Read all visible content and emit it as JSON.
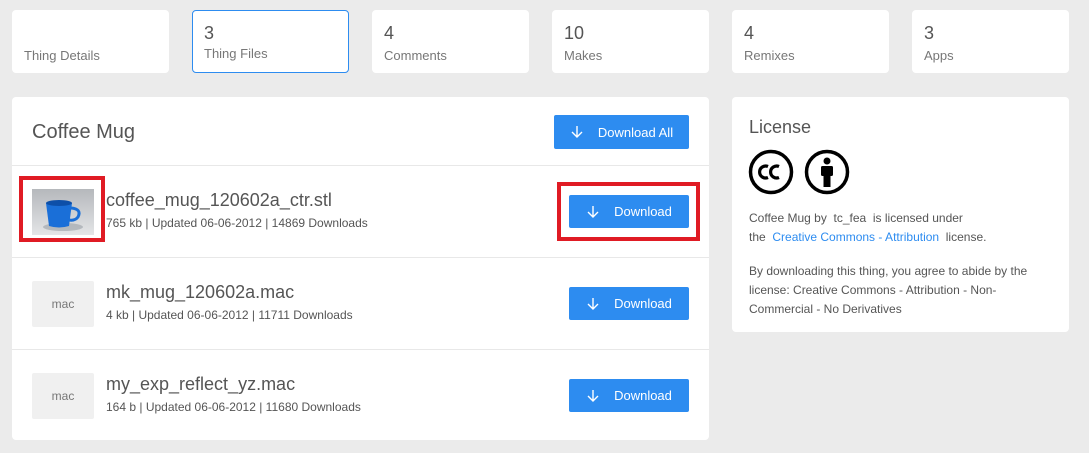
{
  "tabs": [
    {
      "count": "",
      "label": "Thing Details"
    },
    {
      "count": "3",
      "label": "Thing Files"
    },
    {
      "count": "4",
      "label": "Comments"
    },
    {
      "count": "10",
      "label": "Makes"
    },
    {
      "count": "4",
      "label": "Remixes"
    },
    {
      "count": "3",
      "label": "Apps"
    }
  ],
  "files": {
    "title": "Coffee Mug",
    "download_all_label": "Download All",
    "rows": [
      {
        "thumb": "",
        "name": "coffee_mug_120602a_ctr.stl",
        "meta": "765 kb | Updated 06-06-2012 | 14869 Downloads",
        "button": "Download"
      },
      {
        "thumb": "mac",
        "name": "mk_mug_120602a.mac",
        "meta": "4 kb | Updated 06-06-2012 | 11711 Downloads",
        "button": "Download"
      },
      {
        "thumb": "mac",
        "name": "my_exp_reflect_yz.mac",
        "meta": "164 b | Updated 06-06-2012 | 11680 Downloads",
        "button": "Download"
      }
    ]
  },
  "license": {
    "title": "License",
    "icons": [
      "creative-commons-icon",
      "attribution-person-icon"
    ],
    "line1_prefix": "Coffee Mug by",
    "author": "tc_fea",
    "line1_suffix": "is licensed under",
    "line2_prefix": "the",
    "license_link": "Creative Commons - Attribution",
    "line2_suffix": "license.",
    "note": "By downloading this thing, you agree to abide by the license: Creative Commons - Attribution - Non-Commercial - No Derivatives"
  },
  "colors": {
    "accent": "#2d8cf0",
    "highlight": "#e01b24",
    "background": "#ebebeb"
  }
}
